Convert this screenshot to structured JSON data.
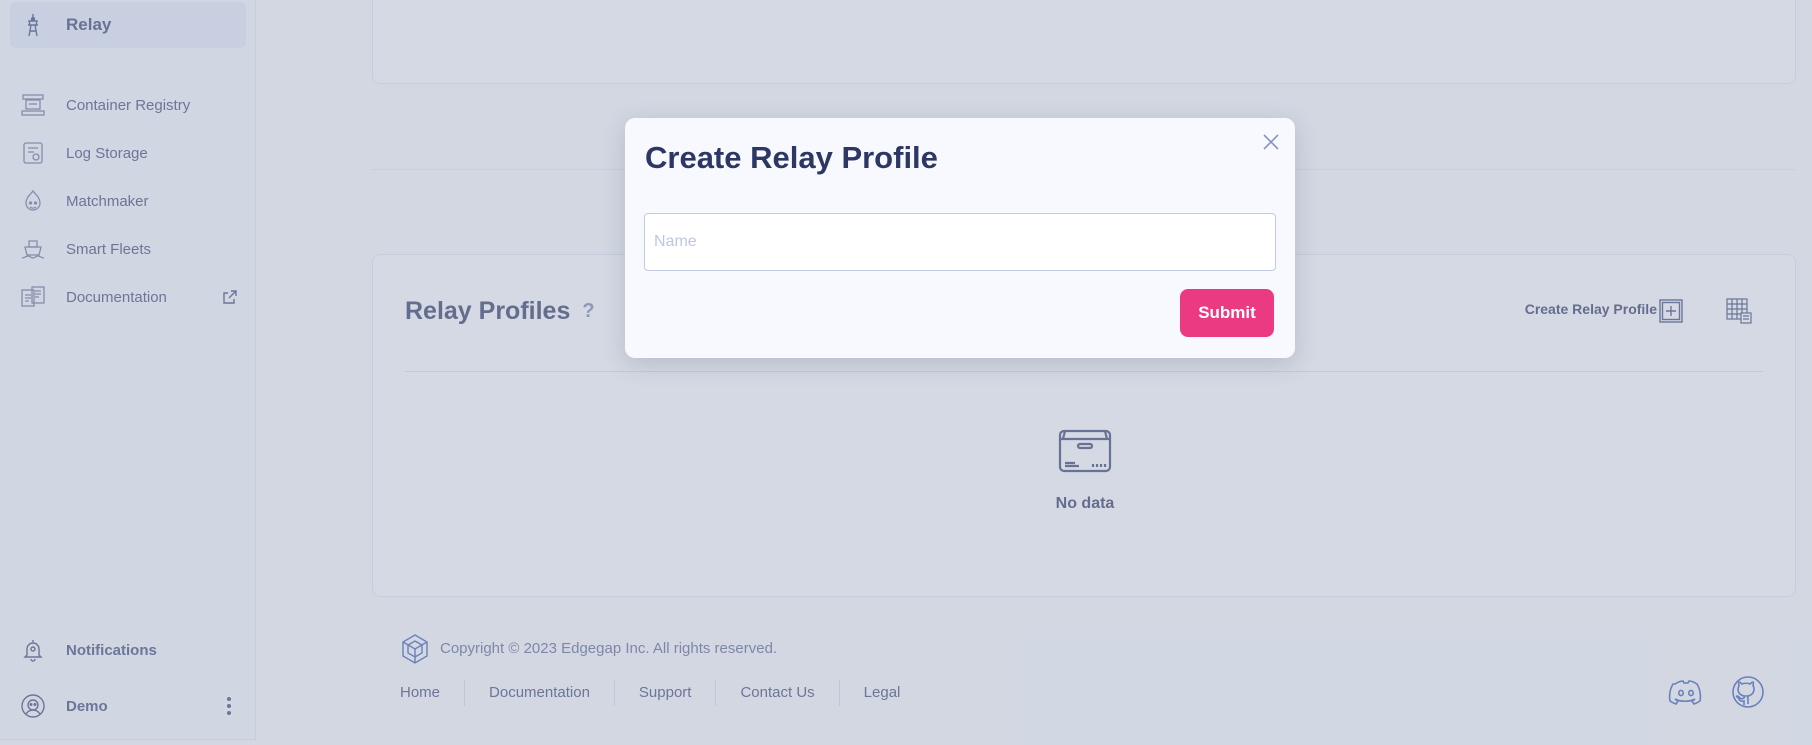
{
  "sidebar": {
    "active_item": {
      "label": "Relay",
      "icon": "tower-icon"
    },
    "items": [
      {
        "label": "Container Registry",
        "icon": "registry-icon"
      },
      {
        "label": "Log Storage",
        "icon": "storage-icon"
      },
      {
        "label": "Matchmaker",
        "icon": "matchmaker-icon"
      },
      {
        "label": "Smart Fleets",
        "icon": "ship-icon"
      },
      {
        "label": "Documentation",
        "icon": "docs-icon",
        "external": true
      }
    ],
    "notifications_label": "Notifications",
    "user_label": "Demo"
  },
  "main": {
    "section_title": "Relay Profiles",
    "help_icon_glyph": "?",
    "create_label": "Create Relay Profile",
    "empty_text": "No data"
  },
  "footer": {
    "copyright": "Copyright © 2023 Edgegap Inc. All rights reserved.",
    "links": [
      "Home",
      "Documentation",
      "Support",
      "Contact Us",
      "Legal"
    ]
  },
  "modal": {
    "title": "Create Relay Profile",
    "name_placeholder": "Name",
    "name_value": "",
    "submit_label": "Submit"
  },
  "colors": {
    "accent": "#ec3a82",
    "text": "#2c3763",
    "sidebar_bg": "#f3f6fc"
  }
}
